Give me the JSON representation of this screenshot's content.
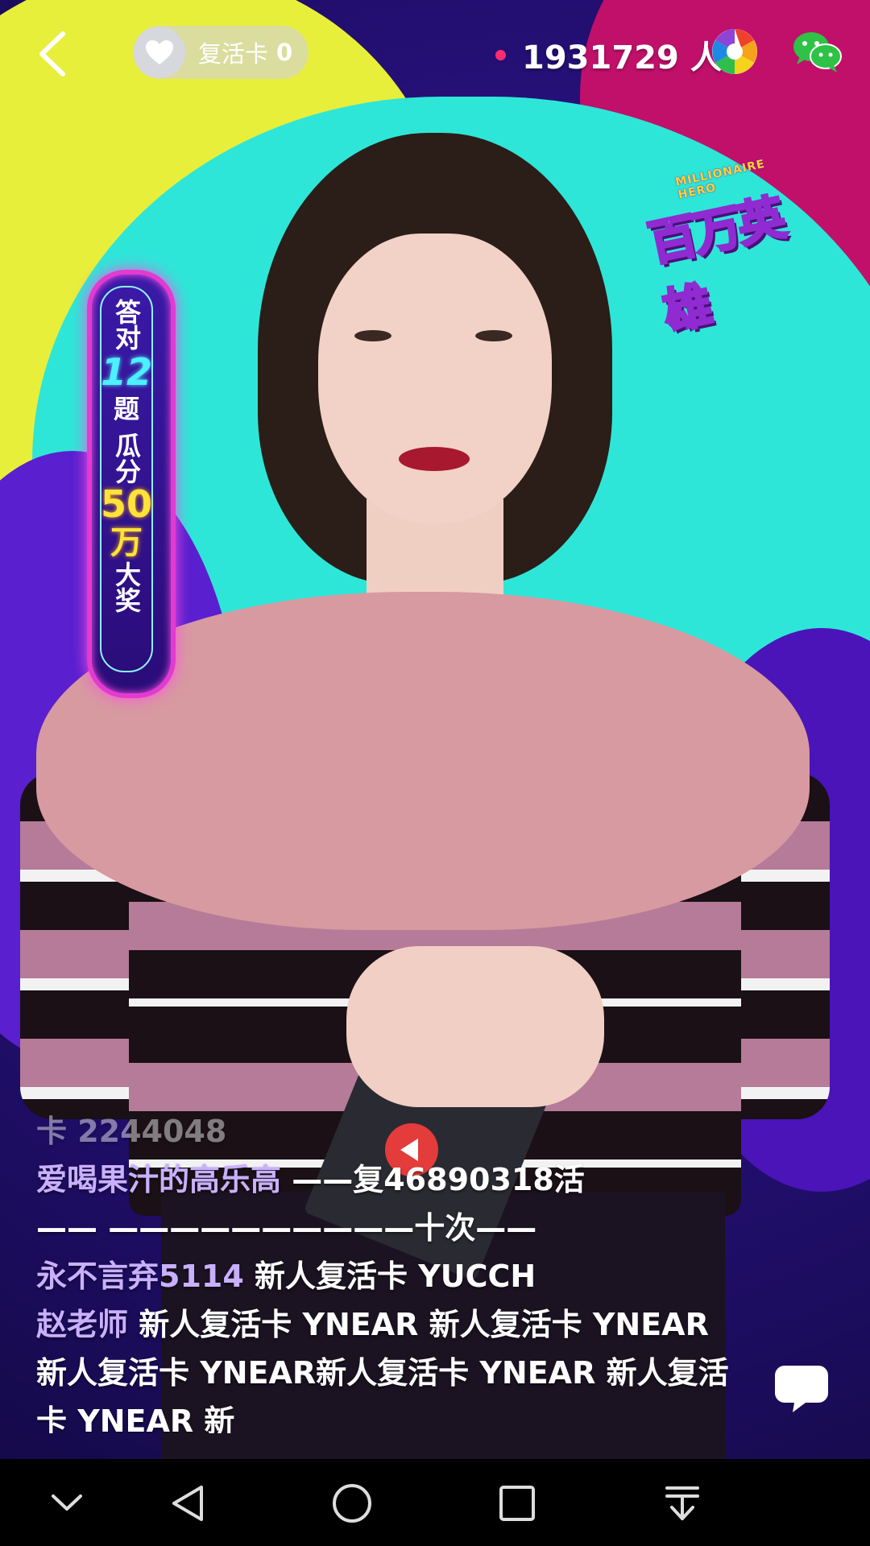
{
  "header": {
    "revive_card_label": "复活卡",
    "revive_card_count": "0",
    "viewer_count": "1931729 人"
  },
  "logo": {
    "subtitle": "MILLIONAIRE HERO",
    "title": "百万英雄"
  },
  "prize_banner": {
    "line1": "答对",
    "questions": "12",
    "line2": "题",
    "line3": "瓜分",
    "amount": "50",
    "unit": "万",
    "line4": "大奖"
  },
  "comments": [
    {
      "user": "",
      "text": "卡  2244048",
      "faded": true
    },
    {
      "user": "爱喝果汁的高乐高",
      "text": " ——复46890318活"
    },
    {
      "user": "",
      "text": "—— ——————————十次——"
    },
    {
      "user": "永不言弃5114",
      "text": " 新人复活卡 YUCCH"
    },
    {
      "user": "赵老师",
      "text": " 新人复活卡 YNEAR 新人复活卡 YNEAR 新人复活卡 YNEAR新人复活卡 YNEAR 新人复活卡 YNEAR 新"
    }
  ],
  "icons": {
    "back": "chevron-left-icon",
    "heart": "heart-icon",
    "share": "aperture-icon",
    "wechat": "wechat-icon",
    "chat": "chat-bubble-icon",
    "nav_down": "chevron-down-icon",
    "nav_back": "triangle-back-icon",
    "nav_home": "circle-home-icon",
    "nav_recent": "square-recents-icon",
    "nav_notifications": "pull-down-icon"
  },
  "colors": {
    "live_dot": "#ff2d6f",
    "username": "#c9b0ff",
    "banner_border": "#e33ad2",
    "prize_yellow": "#ffe23a",
    "question_cyan": "#4cf0ff"
  }
}
